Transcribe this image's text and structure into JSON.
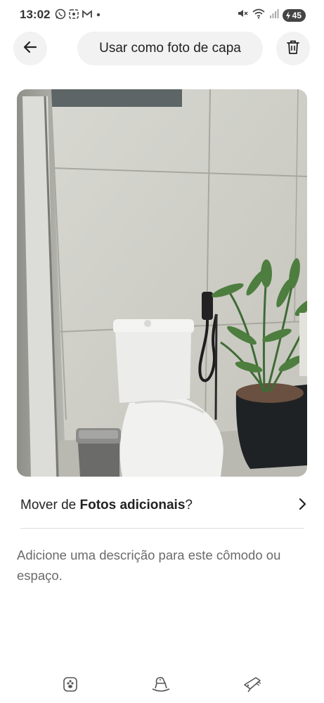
{
  "status_bar": {
    "time": "13:02",
    "battery_level": "45",
    "left_icons": [
      "whatsapp-icon",
      "screenshot-icon",
      "gmail-icon",
      "notification-dot-icon"
    ],
    "right_icons": [
      "mute-icon",
      "wifi-icon",
      "signal-icon",
      "battery-charging-icon"
    ]
  },
  "top_bar": {
    "back_icon": "arrow-left-icon",
    "cover_label": "Usar como foto de capa",
    "delete_icon": "trash-icon"
  },
  "photo": {
    "subject": "bathroom-toilet-plant-photo"
  },
  "move_row": {
    "prefix": "Mover de ",
    "section": "Fotos adicionais",
    "suffix": "?",
    "chevron_icon": "chevron-right-icon"
  },
  "description": {
    "placeholder": "Adicione uma descrição para este cômodo ou espaço."
  },
  "bottom_nav": {
    "icons": [
      "pet-bowl-icon",
      "rocking-horse-icon",
      "hair-dryer-icon"
    ]
  },
  "colors": {
    "button_bg": "#f2f2f2",
    "text_primary": "#222222",
    "text_secondary": "#6a6a6a",
    "divider": "#dddddd"
  }
}
